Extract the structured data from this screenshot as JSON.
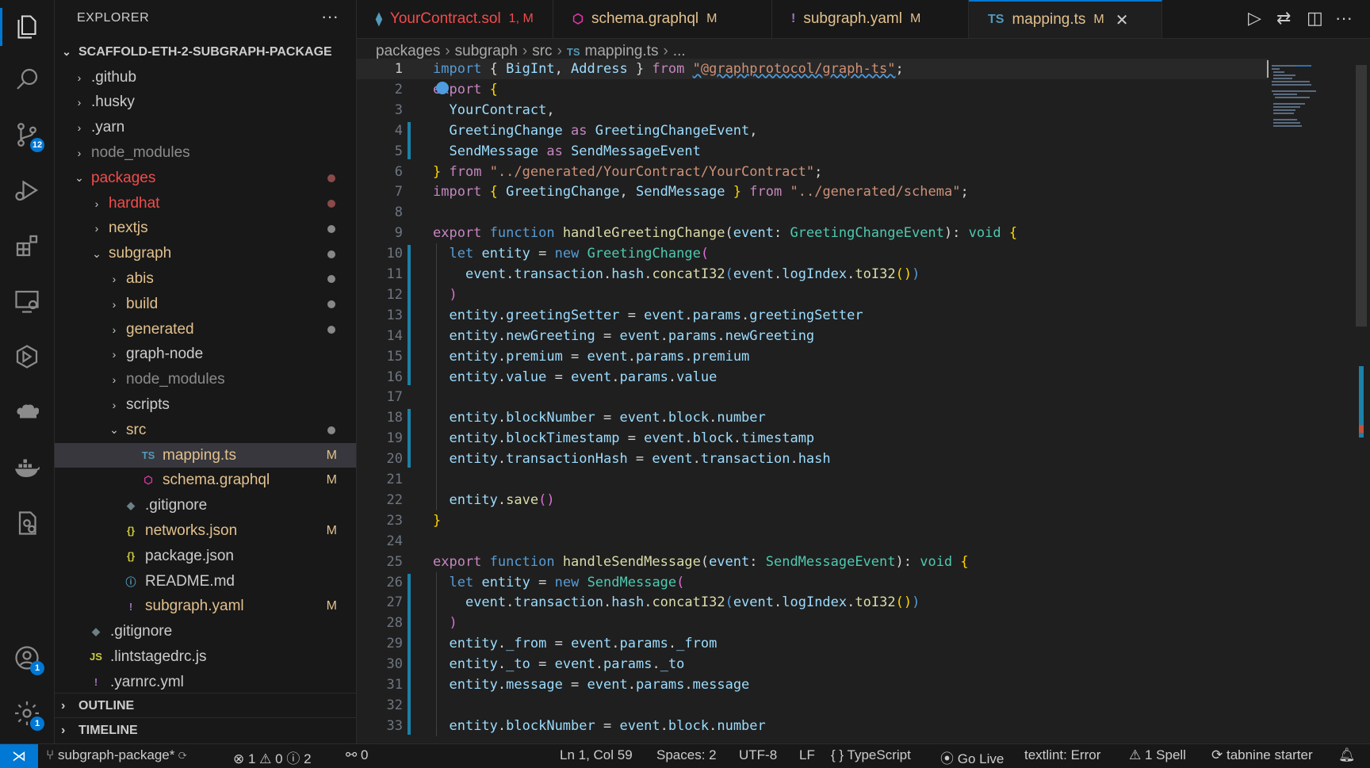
{
  "explorer": {
    "title": "EXPLORER",
    "root": "SCAFFOLD-ETH-2-SUBGRAPH-PACKAGE",
    "items": [
      {
        "label": ".github",
        "depth": 0,
        "type": "folder",
        "open": false,
        "color": "#cccccc"
      },
      {
        "label": ".husky",
        "depth": 0,
        "type": "folder",
        "open": false,
        "color": "#cccccc"
      },
      {
        "label": ".yarn",
        "depth": 0,
        "type": "folder",
        "open": false,
        "color": "#cccccc"
      },
      {
        "label": "node_modules",
        "depth": 0,
        "type": "folder",
        "open": false,
        "color": "#8b8b8b"
      },
      {
        "label": "packages",
        "depth": 0,
        "type": "folder",
        "open": true,
        "color": "#f14c4c",
        "dot": "red"
      },
      {
        "label": "hardhat",
        "depth": 1,
        "type": "folder",
        "open": false,
        "color": "#f14c4c",
        "dot": "red"
      },
      {
        "label": "nextjs",
        "depth": 1,
        "type": "folder",
        "open": false,
        "color": "#e2c08d",
        "dot": "grey"
      },
      {
        "label": "subgraph",
        "depth": 1,
        "type": "folder",
        "open": true,
        "color": "#e2c08d",
        "dot": "grey"
      },
      {
        "label": "abis",
        "depth": 2,
        "type": "folder",
        "open": false,
        "color": "#e2c08d",
        "dot": "grey"
      },
      {
        "label": "build",
        "depth": 2,
        "type": "folder",
        "open": false,
        "color": "#e2c08d",
        "dot": "grey"
      },
      {
        "label": "generated",
        "depth": 2,
        "type": "folder",
        "open": false,
        "color": "#e2c08d",
        "dot": "grey"
      },
      {
        "label": "graph-node",
        "depth": 2,
        "type": "folder",
        "open": false,
        "color": "#cccccc"
      },
      {
        "label": "node_modules",
        "depth": 2,
        "type": "folder",
        "open": false,
        "color": "#8b8b8b"
      },
      {
        "label": "scripts",
        "depth": 2,
        "type": "folder",
        "open": false,
        "color": "#cccccc"
      },
      {
        "label": "src",
        "depth": 2,
        "type": "folder",
        "open": true,
        "color": "#e2c08d",
        "dot": "grey"
      },
      {
        "label": "mapping.ts",
        "depth": 3,
        "type": "file",
        "icon": "TS",
        "iconColor": "#519aba",
        "color": "#e2c08d",
        "mark": "M",
        "selected": true
      },
      {
        "label": "schema.graphql",
        "depth": 3,
        "type": "file",
        "icon": "⬡",
        "iconColor": "#e535ab",
        "color": "#e2c08d",
        "mark": "M"
      },
      {
        "label": ".gitignore",
        "depth": 2,
        "type": "file",
        "icon": "◆",
        "iconColor": "#6d8086",
        "color": "#cccccc"
      },
      {
        "label": "networks.json",
        "depth": 2,
        "type": "file",
        "icon": "{}",
        "iconColor": "#cbcb41",
        "color": "#e2c08d",
        "mark": "M"
      },
      {
        "label": "package.json",
        "depth": 2,
        "type": "file",
        "icon": "{}",
        "iconColor": "#cbcb41",
        "color": "#cccccc"
      },
      {
        "label": "README.md",
        "depth": 2,
        "type": "file",
        "icon": "ⓘ",
        "iconColor": "#519aba",
        "color": "#cccccc"
      },
      {
        "label": "subgraph.yaml",
        "depth": 2,
        "type": "file",
        "icon": "!",
        "iconColor": "#a074c4",
        "color": "#e2c08d",
        "mark": "M"
      },
      {
        "label": ".gitignore",
        "depth": 0,
        "type": "file",
        "icon": "◆",
        "iconColor": "#6d8086",
        "color": "#cccccc"
      },
      {
        "label": ".lintstagedrc.js",
        "depth": 0,
        "type": "file",
        "icon": "JS",
        "iconColor": "#cbcb41",
        "color": "#cccccc"
      },
      {
        "label": ".yarnrc.yml",
        "depth": 0,
        "type": "file",
        "icon": "!",
        "iconColor": "#a074c4",
        "color": "#cccccc"
      }
    ],
    "outline": "OUTLINE",
    "timeline": "TIMELINE"
  },
  "activity": {
    "scm_badge": "12",
    "accounts_badge": "1",
    "settings_badge": "1"
  },
  "tabs": [
    {
      "label": "YourContract.sol",
      "mark": "1, M",
      "icon": "⧫",
      "iconColor": "#519aba",
      "color": "#f14c4c",
      "markColor": "#f14c4c"
    },
    {
      "label": "schema.graphql",
      "mark": "M",
      "icon": "⬡",
      "iconColor": "#e535ab",
      "color": "#e2c08d",
      "markColor": "#e2c08d"
    },
    {
      "label": "subgraph.yaml",
      "mark": "M",
      "icon": "!",
      "iconColor": "#a074c4",
      "color": "#e2c08d",
      "markColor": "#e2c08d"
    },
    {
      "label": "mapping.ts",
      "mark": "M",
      "icon": "TS",
      "iconColor": "#519aba",
      "color": "#e2c08d",
      "markColor": "#e2c08d",
      "active": true
    }
  ],
  "breadcrumbs": [
    "packages",
    "subgraph",
    "src",
    "mapping.ts",
    "..."
  ],
  "breadcrumb_file_icon": "TS",
  "code": [
    [
      [
        "k",
        "import"
      ],
      [
        "p",
        " { "
      ],
      [
        "v",
        "BigInt"
      ],
      [
        "p",
        ", "
      ],
      [
        "v",
        "Address"
      ],
      [
        "p",
        " } "
      ],
      [
        "c",
        "from"
      ],
      [
        "p",
        " "
      ],
      [
        "s",
        "\"@graphprotocol/graph-ts\""
      ],
      [
        "p",
        ";"
      ]
    ],
    [
      [
        "c",
        "export"
      ],
      [
        "p",
        " "
      ],
      [
        "y",
        "{"
      ]
    ],
    [
      [
        "p",
        "  "
      ],
      [
        "v",
        "YourContract"
      ],
      [
        "p",
        ","
      ]
    ],
    [
      [
        "p",
        "  "
      ],
      [
        "v",
        "GreetingChange"
      ],
      [
        "p",
        " "
      ],
      [
        "c",
        "as"
      ],
      [
        "p",
        " "
      ],
      [
        "v",
        "GreetingChangeEvent"
      ],
      [
        "p",
        ","
      ]
    ],
    [
      [
        "p",
        "  "
      ],
      [
        "v",
        "SendMessage"
      ],
      [
        "p",
        " "
      ],
      [
        "c",
        "as"
      ],
      [
        "p",
        " "
      ],
      [
        "v",
        "SendMessageEvent"
      ]
    ],
    [
      [
        "y",
        "}"
      ],
      [
        "p",
        " "
      ],
      [
        "c",
        "from"
      ],
      [
        "p",
        " "
      ],
      [
        "s",
        "\"../generated/YourContract/YourContract\""
      ],
      [
        "p",
        ";"
      ]
    ],
    [
      [
        "c",
        "import"
      ],
      [
        "p",
        " "
      ],
      [
        "y",
        "{"
      ],
      [
        "p",
        " "
      ],
      [
        "v",
        "GreetingChange"
      ],
      [
        "p",
        ", "
      ],
      [
        "v",
        "SendMessage"
      ],
      [
        "p",
        " "
      ],
      [
        "y",
        "}"
      ],
      [
        "p",
        " "
      ],
      [
        "c",
        "from"
      ],
      [
        "p",
        " "
      ],
      [
        "s",
        "\"../generated/schema\""
      ],
      [
        "p",
        ";"
      ]
    ],
    [],
    [
      [
        "c",
        "export"
      ],
      [
        "p",
        " "
      ],
      [
        "k",
        "function"
      ],
      [
        "p",
        " "
      ],
      [
        "f",
        "handleGreetingChange"
      ],
      [
        "p",
        "("
      ],
      [
        "v",
        "event"
      ],
      [
        "p",
        ": "
      ],
      [
        "t",
        "GreetingChangeEvent"
      ],
      [
        "p",
        "): "
      ],
      [
        "t",
        "void"
      ],
      [
        "p",
        " "
      ],
      [
        "y",
        "{"
      ]
    ],
    [
      [
        "p",
        "  "
      ],
      [
        "k",
        "let"
      ],
      [
        "p",
        " "
      ],
      [
        "v",
        "entity"
      ],
      [
        "p",
        " = "
      ],
      [
        "k",
        "new"
      ],
      [
        "p",
        " "
      ],
      [
        "t",
        "GreetingChange"
      ],
      [
        "m",
        "("
      ]
    ],
    [
      [
        "p",
        "    "
      ],
      [
        "v",
        "event"
      ],
      [
        "p",
        "."
      ],
      [
        "v",
        "transaction"
      ],
      [
        "p",
        "."
      ],
      [
        "v",
        "hash"
      ],
      [
        "p",
        "."
      ],
      [
        "f",
        "concatI32"
      ],
      [
        "k",
        "("
      ],
      [
        "v",
        "event"
      ],
      [
        "p",
        "."
      ],
      [
        "v",
        "logIndex"
      ],
      [
        "p",
        "."
      ],
      [
        "f",
        "toI32"
      ],
      [
        "y",
        "()"
      ],
      [
        "k",
        ")"
      ]
    ],
    [
      [
        "p",
        "  "
      ],
      [
        "m",
        ")"
      ]
    ],
    [
      [
        "p",
        "  "
      ],
      [
        "v",
        "entity"
      ],
      [
        "p",
        "."
      ],
      [
        "v",
        "greetingSetter"
      ],
      [
        "p",
        " = "
      ],
      [
        "v",
        "event"
      ],
      [
        "p",
        "."
      ],
      [
        "v",
        "params"
      ],
      [
        "p",
        "."
      ],
      [
        "v",
        "greetingSetter"
      ]
    ],
    [
      [
        "p",
        "  "
      ],
      [
        "v",
        "entity"
      ],
      [
        "p",
        "."
      ],
      [
        "v",
        "newGreeting"
      ],
      [
        "p",
        " = "
      ],
      [
        "v",
        "event"
      ],
      [
        "p",
        "."
      ],
      [
        "v",
        "params"
      ],
      [
        "p",
        "."
      ],
      [
        "v",
        "newGreeting"
      ]
    ],
    [
      [
        "p",
        "  "
      ],
      [
        "v",
        "entity"
      ],
      [
        "p",
        "."
      ],
      [
        "v",
        "premium"
      ],
      [
        "p",
        " = "
      ],
      [
        "v",
        "event"
      ],
      [
        "p",
        "."
      ],
      [
        "v",
        "params"
      ],
      [
        "p",
        "."
      ],
      [
        "v",
        "premium"
      ]
    ],
    [
      [
        "p",
        "  "
      ],
      [
        "v",
        "entity"
      ],
      [
        "p",
        "."
      ],
      [
        "v",
        "value"
      ],
      [
        "p",
        " = "
      ],
      [
        "v",
        "event"
      ],
      [
        "p",
        "."
      ],
      [
        "v",
        "params"
      ],
      [
        "p",
        "."
      ],
      [
        "v",
        "value"
      ]
    ],
    [],
    [
      [
        "p",
        "  "
      ],
      [
        "v",
        "entity"
      ],
      [
        "p",
        "."
      ],
      [
        "v",
        "blockNumber"
      ],
      [
        "p",
        " = "
      ],
      [
        "v",
        "event"
      ],
      [
        "p",
        "."
      ],
      [
        "v",
        "block"
      ],
      [
        "p",
        "."
      ],
      [
        "v",
        "number"
      ]
    ],
    [
      [
        "p",
        "  "
      ],
      [
        "v",
        "entity"
      ],
      [
        "p",
        "."
      ],
      [
        "v",
        "blockTimestamp"
      ],
      [
        "p",
        " = "
      ],
      [
        "v",
        "event"
      ],
      [
        "p",
        "."
      ],
      [
        "v",
        "block"
      ],
      [
        "p",
        "."
      ],
      [
        "v",
        "timestamp"
      ]
    ],
    [
      [
        "p",
        "  "
      ],
      [
        "v",
        "entity"
      ],
      [
        "p",
        "."
      ],
      [
        "v",
        "transactionHash"
      ],
      [
        "p",
        " = "
      ],
      [
        "v",
        "event"
      ],
      [
        "p",
        "."
      ],
      [
        "v",
        "transaction"
      ],
      [
        "p",
        "."
      ],
      [
        "v",
        "hash"
      ]
    ],
    [],
    [
      [
        "p",
        "  "
      ],
      [
        "v",
        "entity"
      ],
      [
        "p",
        "."
      ],
      [
        "f",
        "save"
      ],
      [
        "m",
        "()"
      ]
    ],
    [
      [
        "y",
        "}"
      ]
    ],
    [],
    [
      [
        "c",
        "export"
      ],
      [
        "p",
        " "
      ],
      [
        "k",
        "function"
      ],
      [
        "p",
        " "
      ],
      [
        "f",
        "handleSendMessage"
      ],
      [
        "p",
        "("
      ],
      [
        "v",
        "event"
      ],
      [
        "p",
        ": "
      ],
      [
        "t",
        "SendMessageEvent"
      ],
      [
        "p",
        "): "
      ],
      [
        "t",
        "void"
      ],
      [
        "p",
        " "
      ],
      [
        "y",
        "{"
      ]
    ],
    [
      [
        "p",
        "  "
      ],
      [
        "k",
        "let"
      ],
      [
        "p",
        " "
      ],
      [
        "v",
        "entity"
      ],
      [
        "p",
        " = "
      ],
      [
        "k",
        "new"
      ],
      [
        "p",
        " "
      ],
      [
        "t",
        "SendMessage"
      ],
      [
        "m",
        "("
      ]
    ],
    [
      [
        "p",
        "    "
      ],
      [
        "v",
        "event"
      ],
      [
        "p",
        "."
      ],
      [
        "v",
        "transaction"
      ],
      [
        "p",
        "."
      ],
      [
        "v",
        "hash"
      ],
      [
        "p",
        "."
      ],
      [
        "f",
        "concatI32"
      ],
      [
        "k",
        "("
      ],
      [
        "v",
        "event"
      ],
      [
        "p",
        "."
      ],
      [
        "v",
        "logIndex"
      ],
      [
        "p",
        "."
      ],
      [
        "f",
        "toI32"
      ],
      [
        "y",
        "()"
      ],
      [
        "k",
        ")"
      ]
    ],
    [
      [
        "p",
        "  "
      ],
      [
        "m",
        ")"
      ]
    ],
    [
      [
        "p",
        "  "
      ],
      [
        "v",
        "entity"
      ],
      [
        "p",
        "."
      ],
      [
        "v",
        "_from"
      ],
      [
        "p",
        " = "
      ],
      [
        "v",
        "event"
      ],
      [
        "p",
        "."
      ],
      [
        "v",
        "params"
      ],
      [
        "p",
        "."
      ],
      [
        "v",
        "_from"
      ]
    ],
    [
      [
        "p",
        "  "
      ],
      [
        "v",
        "entity"
      ],
      [
        "p",
        "."
      ],
      [
        "v",
        "_to"
      ],
      [
        "p",
        " = "
      ],
      [
        "v",
        "event"
      ],
      [
        "p",
        "."
      ],
      [
        "v",
        "params"
      ],
      [
        "p",
        "."
      ],
      [
        "v",
        "_to"
      ]
    ],
    [
      [
        "p",
        "  "
      ],
      [
        "v",
        "entity"
      ],
      [
        "p",
        "."
      ],
      [
        "v",
        "message"
      ],
      [
        "p",
        " = "
      ],
      [
        "v",
        "event"
      ],
      [
        "p",
        "."
      ],
      [
        "v",
        "params"
      ],
      [
        "p",
        "."
      ],
      [
        "v",
        "message"
      ]
    ],
    [],
    [
      [
        "p",
        "  "
      ],
      [
        "v",
        "entity"
      ],
      [
        "p",
        "."
      ],
      [
        "v",
        "blockNumber"
      ],
      [
        "p",
        " = "
      ],
      [
        "v",
        "event"
      ],
      [
        "p",
        "."
      ],
      [
        "v",
        "block"
      ],
      [
        "p",
        "."
      ],
      [
        "v",
        "number"
      ]
    ]
  ],
  "status": {
    "branch": "subgraph-package*",
    "errors": "1",
    "warnings": "0",
    "info": "2",
    "ports": "0",
    "position": "Ln 1, Col 59",
    "spaces": "Spaces: 2",
    "encoding": "UTF-8",
    "eol": "LF",
    "language": "TypeScript",
    "golive": "Go Live",
    "textlint": "textlint: Error",
    "spell": "1 Spell",
    "tabnine": "tabnine starter"
  }
}
